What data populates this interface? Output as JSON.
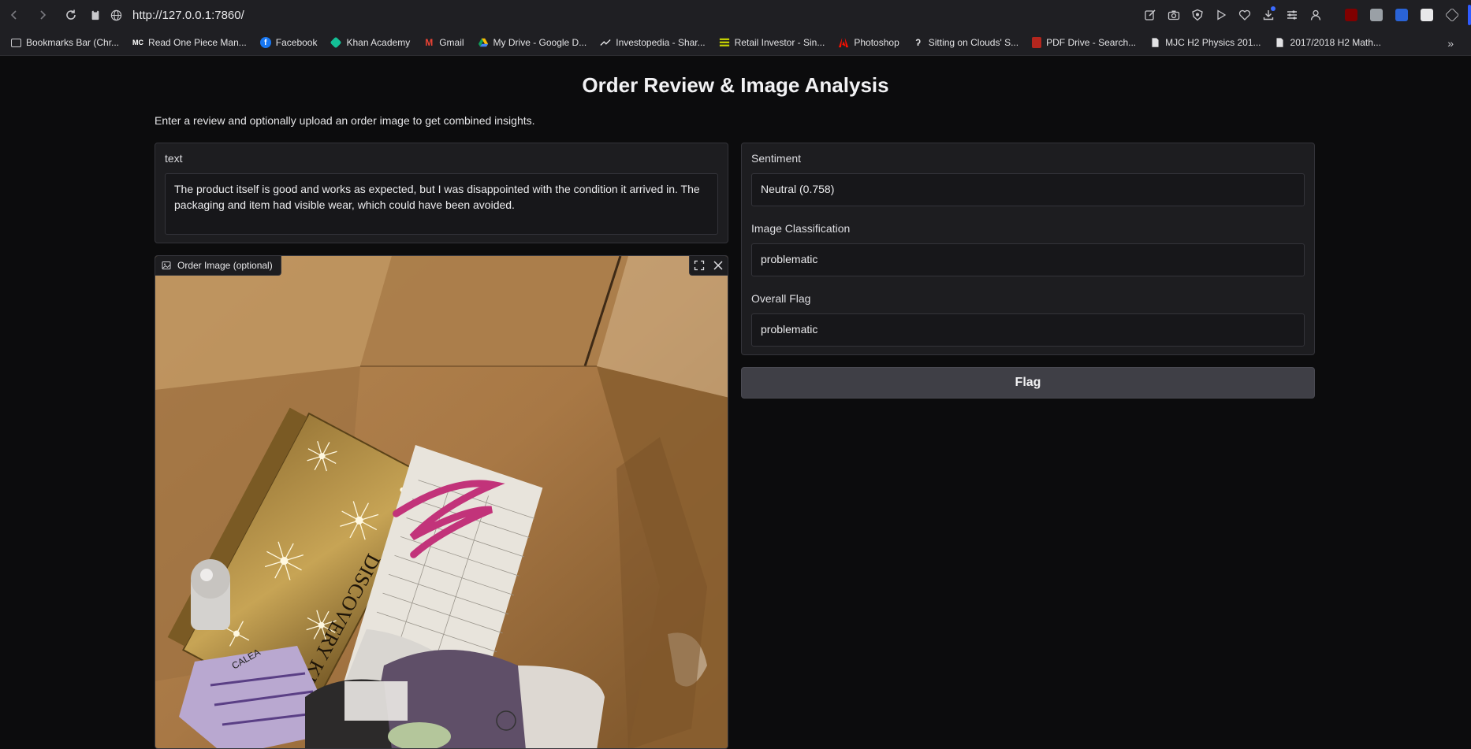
{
  "browser": {
    "url": "http://127.0.0.1:7860/",
    "bookmarks": [
      {
        "label": "Bookmarks Bar (Chr...",
        "icon": "folder-icon"
      },
      {
        "label": "Read One Piece Man...",
        "icon": "mc-icon"
      },
      {
        "label": "Facebook",
        "icon": "facebook-icon"
      },
      {
        "label": "Khan Academy",
        "icon": "khan-academy-icon"
      },
      {
        "label": "Gmail",
        "icon": "gmail-icon"
      },
      {
        "label": "My Drive - Google D...",
        "icon": "google-drive-icon"
      },
      {
        "label": "Investopedia - Shar...",
        "icon": "investopedia-icon"
      },
      {
        "label": "Retail Investor - Sin...",
        "icon": "retail-investor-icon"
      },
      {
        "label": "Photoshop",
        "icon": "adobe-icon"
      },
      {
        "label": "Sitting on Clouds' S...",
        "icon": "clouds-icon"
      },
      {
        "label": "PDF Drive - Search...",
        "icon": "pdf-drive-icon"
      },
      {
        "label": "MJC H2 Physics 201...",
        "icon": "document-icon"
      },
      {
        "label": "2017/2018 H2 Math...",
        "icon": "document-icon"
      }
    ],
    "more_label": "»"
  },
  "app": {
    "title": "Order Review & Image Analysis",
    "description": "Enter a review and optionally upload an order image to get combined insights.",
    "text_input": {
      "label": "text",
      "value": "The product itself is good and works as expected, but I was disappointed with the condition it arrived in. The packaging and item had visible wear, which could have been avoided."
    },
    "image_input": {
      "label": "Order Image (optional)"
    },
    "outputs": {
      "sentiment_label": "Sentiment",
      "sentiment_value": "Neutral (0.758)",
      "classification_label": "Image Classification",
      "classification_value": "problematic",
      "overall_label": "Overall Flag",
      "overall_value": "problematic"
    },
    "flag_button": "Flag"
  },
  "colors": {
    "background": "#0c0c0d",
    "card": "#1d1d20",
    "button": "#3f3f46",
    "accent_blue": "#2f5bff"
  }
}
